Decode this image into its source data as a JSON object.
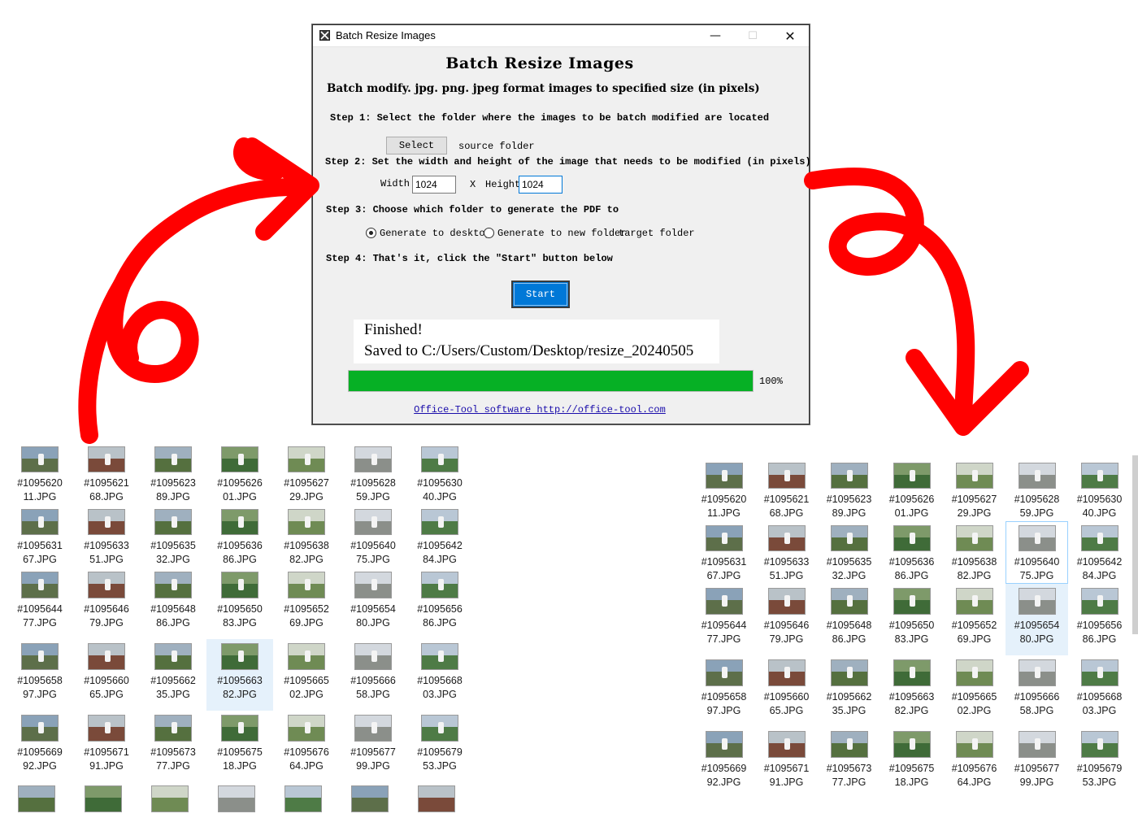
{
  "window": {
    "title": "Batch Resize Images",
    "controls": {
      "minimize": "—",
      "maximize": "☐",
      "close": "✕"
    }
  },
  "heading": "Batch Resize Images",
  "subheading": "Batch modify. jpg. png. jpeg format images to specified size (in pixels)",
  "step1": {
    "label": "Step 1: Select the folder where the images to be batch modified are located",
    "button": "Select",
    "folder_text": "source folder"
  },
  "step2": {
    "label": "Step 2: Set the width and height of the image that needs to be modified (in pixels)",
    "width_label": "Width",
    "width_value": "1024",
    "x_label": "X",
    "height_label": "Height",
    "height_value": "1024"
  },
  "step3": {
    "label": "Step 3: Choose which folder to generate the PDF to",
    "option_desktop": "Generate to desktop",
    "option_new_folder": "Generate to new folder",
    "target_folder": "target folder",
    "selected": "desktop"
  },
  "step4": {
    "label": "Step 4: That's it, click the \"Start\" button below",
    "start_button": "Start"
  },
  "status": {
    "line1": "Finished!",
    "line2": "Saved to C:/Users/Custom/Desktop/resize_20240505"
  },
  "progress": {
    "value": 1.0,
    "label": "100%"
  },
  "footer_link": "Office-Tool software http://office-tool.com",
  "colors": {
    "accent": "#0078d7",
    "progress": "#06b025",
    "arrow": "#ff0000",
    "link": "#1a0dab"
  },
  "files_left": [
    "#109562011.JPG",
    "#109562168.JPG",
    "#109562389.JPG",
    "#109562601.JPG",
    "#109562729.JPG",
    "#109562859.JPG",
    "#109563040.JPG",
    "#109563167.JPG",
    "#109563351.JPG",
    "#109563532.JPG",
    "#109563686.JPG",
    "#109563882.JPG",
    "#109564075.JPG",
    "#109564284.JPG",
    "#109564477.JPG",
    "#109564679.JPG",
    "#109564886.JPG",
    "#109565083.JPG",
    "#109565269.JPG",
    "#109565480.JPG",
    "#109565686.JPG",
    "#109565897.JPG",
    "#109566065.JPG",
    "#109566235.JPG",
    "#109566382.JPG",
    "#109566502.JPG",
    "#109566658.JPG",
    "#109566803.JPG",
    "#109566992.JPG",
    "#109567191.JPG",
    "#109567377.JPG",
    "#109567518.JPG",
    "#109567664.JPG",
    "#109567799.JPG",
    "#109567953.JPG"
  ],
  "files_right": [
    "#109562011.JPG",
    "#109562168.JPG",
    "#109562389.JPG",
    "#109562601.JPG",
    "#109562729.JPG",
    "#109562859.JPG",
    "#109563040.JPG",
    "#109563167.JPG",
    "#109563351.JPG",
    "#109563532.JPG",
    "#109563686.JPG",
    "#109563882.JPG",
    "#109564075.JPG",
    "#109564284.JPG",
    "#109564477.JPG",
    "#109564679.JPG",
    "#109564886.JPG",
    "#109565083.JPG",
    "#109565269.JPG",
    "#109565480.JPG",
    "#109565686.JPG",
    "#109565897.JPG",
    "#109566065.JPG",
    "#109566235.JPG",
    "#109566382.JPG",
    "#109566502.JPG",
    "#109566658.JPG",
    "#109566803.JPG",
    "#109566992.JPG",
    "#109567191.JPG",
    "#109567377.JPG",
    "#109567518.JPG",
    "#109567664.JPG",
    "#109567799.JPG",
    "#109567953.JPG"
  ],
  "selected_left_index": 24,
  "highlighted_right_index": 12,
  "selected_right_index": 19
}
